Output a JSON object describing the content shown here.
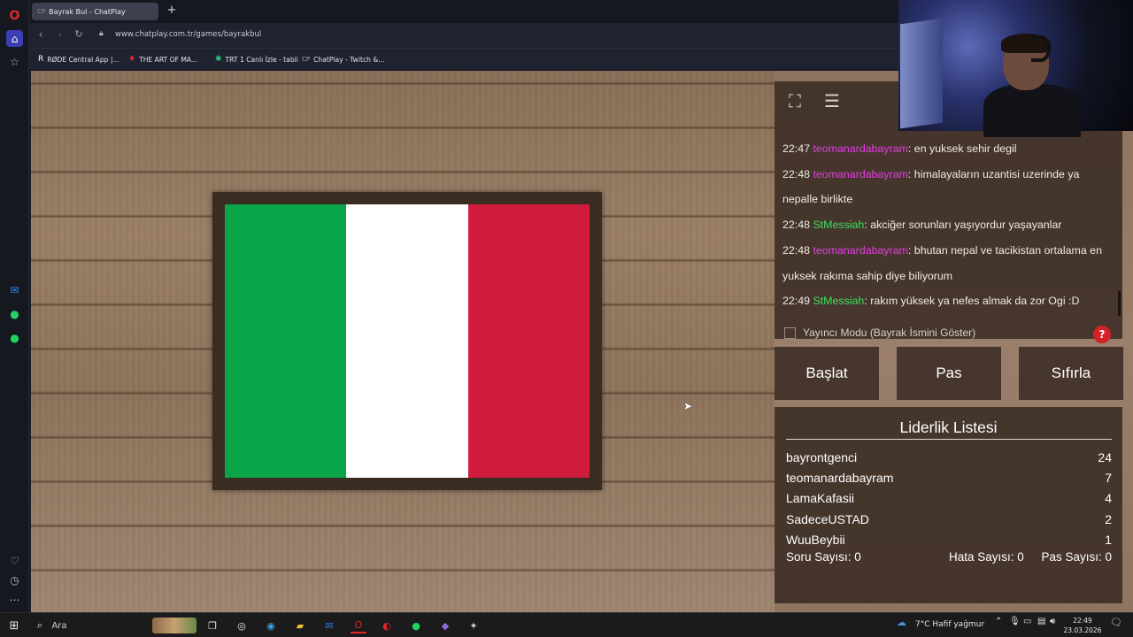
{
  "browser": {
    "tab_title": "Bayrak Bul - ChatPlay",
    "tab_favicon": "CP",
    "url": "www.chatplay.com.tr/games/bayrakbul",
    "bookmarks": [
      {
        "label": "RØDE Central App |...",
        "icon": "R"
      },
      {
        "label": "THE ART OF MA...",
        "icon": "♦"
      },
      {
        "label": "TRT 1 Canlı İzle - tabii",
        "icon": "✱"
      },
      {
        "label": "ChatPlay - Twitch &...",
        "icon": "CP"
      }
    ]
  },
  "game": {
    "flag_colors": [
      "#0aa548",
      "#ffffff",
      "#cf1c3c"
    ]
  },
  "chat": {
    "messages": [
      {
        "time": "22:47",
        "user": "teomanardabayram",
        "color": "#e23ee0",
        "text": ": en yuksek sehir degil"
      },
      {
        "time": "22:48",
        "user": "teomanardabayram",
        "color": "#e23ee0",
        "text": ": himalayaların uzantisi uzerinde ya nepalle birlikte"
      },
      {
        "time": "22:48",
        "user": "StMessiah",
        "color": "#3fe05c",
        "text": ": akciğer sorunları yaşıyordur yaşayanlar"
      },
      {
        "time": "22:48",
        "user": "teomanardabayram",
        "color": "#e23ee0",
        "text": ": bhutan nepal ve tacikistan ortalama en yuksek rakıma sahip diye biliyorum"
      },
      {
        "time": "22:49",
        "user": "StMessiah",
        "color": "#3fe05c",
        "text": ": rakım yüksek ya nefes almak da zor Ogi :D"
      }
    ],
    "streamer_mode_label": "Yayıncı Modu (Bayrak İsmini Göster)",
    "help_label": "?"
  },
  "buttons": {
    "start": "Başlat",
    "pass": "Pas",
    "reset": "Sıfırla"
  },
  "leaderboard": {
    "title": "Liderlik Listesi",
    "entries": [
      {
        "name": "bayrontgenci",
        "score": "24"
      },
      {
        "name": "teomanardabayram",
        "score": "7"
      },
      {
        "name": "LamaKafasii",
        "score": "4"
      },
      {
        "name": "SadeceUSTAD",
        "score": "2"
      },
      {
        "name": "WuuBeybii",
        "score": "1"
      }
    ],
    "question_count": "Soru Sayısı: 0",
    "error_count": "Hata Sayısı: 0",
    "pass_count": "Pas Sayısı: 0"
  },
  "taskbar": {
    "search_label": "Ara",
    "weather": "7°C  Hafif yağmur",
    "time": "22:49",
    "date": "23.03.2026"
  }
}
